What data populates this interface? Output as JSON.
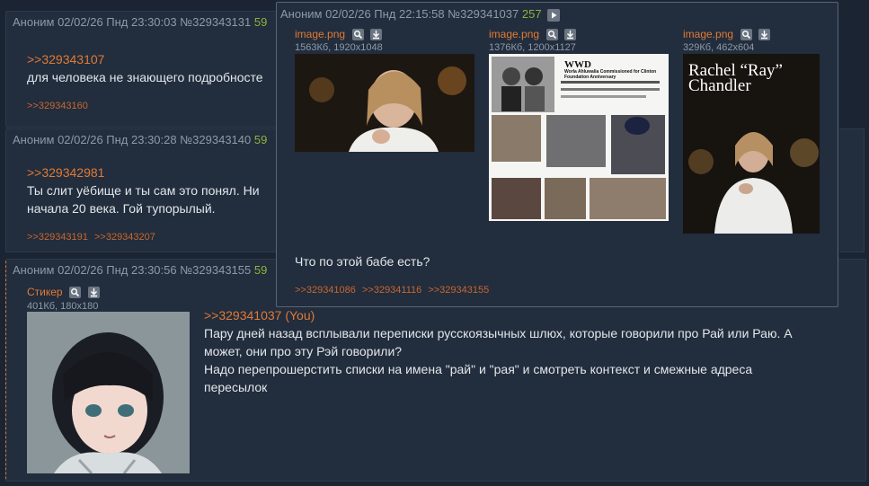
{
  "posts": [
    {
      "header": "Аноним 02/02/26 Пнд 23:30:03 №329343131",
      "count": "59",
      "reply": ">>329343107",
      "lines": [
        "для человека не знающего подробносте"
      ],
      "backrefs": [
        ">>329343160"
      ]
    },
    {
      "header": "Аноним 02/02/26 Пнд 23:30:28 №329343140",
      "count": "59",
      "reply": ">>329342981",
      "lines": [
        "Ты слит уёбище и ты сам это понял. Ни",
        "начала 20 века. Гой тупорылый."
      ],
      "backrefs": [
        ">>329343191",
        ">>329343207"
      ]
    },
    {
      "header": "Аноним 02/02/26 Пнд 23:30:56 №329343155",
      "count": "59",
      "file_name": "Стикер",
      "file_meta": "401Кб, 180x180",
      "reply": ">>329341037 (You)",
      "lines": [
        "Пару дней назад всплывали переписки русскоязычных шлюх, которые говорили про Рай или Раю. А",
        "может, они про эту Рэй говорили?",
        "Надо перепрошерстить списки на имена \"рай\" и \"рая\" и смотреть контекст и смежные адреса",
        "пересылок"
      ]
    }
  ],
  "popup": {
    "header": "Аноним 02/02/26 Пнд 22:15:58 №329341037",
    "count": "257",
    "files": [
      {
        "name": "image.png",
        "meta": "1563Кб, 1920x1048"
      },
      {
        "name": "image.png",
        "meta": "1376Кб, 1200x1127"
      },
      {
        "name": "image.png",
        "meta": "329Кб, 462x604"
      }
    ],
    "collage_title": "Worla Ahluwalia Commissioned for Clinton Foundation Anniversary",
    "collage_brand": "WWD",
    "poster_title_1": "Rachel “Ray”",
    "poster_title_2": "Chandler",
    "message": "Что по этой бабе есть?",
    "backrefs": [
      ">>329341086",
      ">>329341116",
      ">>329343155"
    ]
  }
}
